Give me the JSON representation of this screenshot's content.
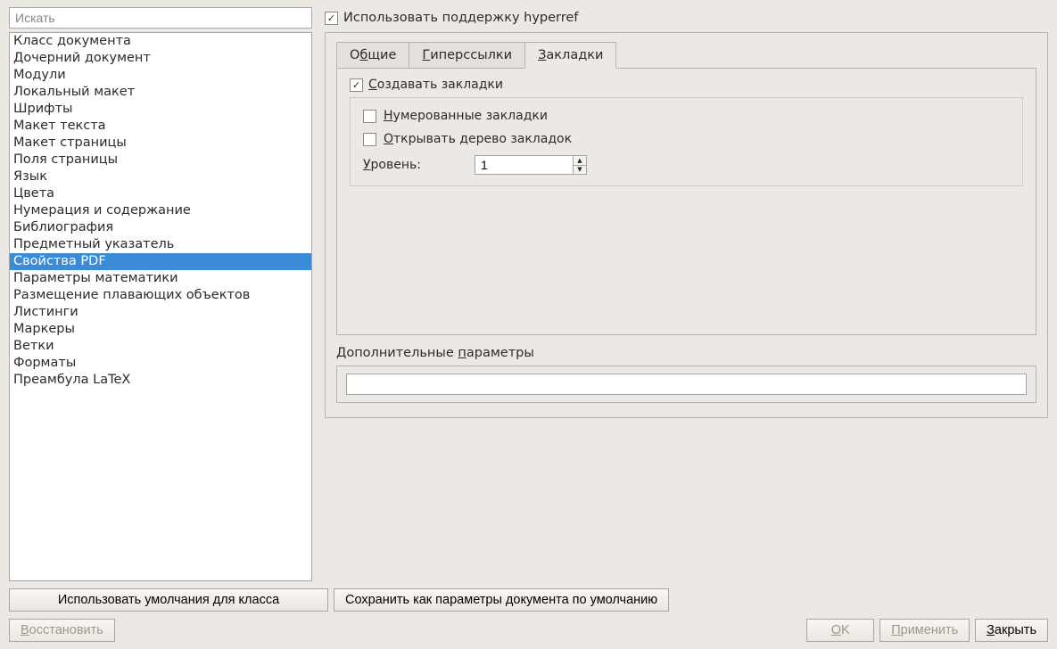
{
  "search": {
    "placeholder": "Искать"
  },
  "categories": [
    "Класс документа",
    "Дочерний документ",
    "Модули",
    "Локальный макет",
    "Шрифты",
    "Макет текста",
    "Макет страницы",
    "Поля страницы",
    "Язык",
    "Цвета",
    "Нумерация и содержание",
    "Библиография",
    "Предметный указатель",
    "Свойства PDF",
    "Параметры математики",
    "Размещение плавающих объектов",
    "Листинги",
    "Маркеры",
    "Ветки",
    "Форматы",
    "Преамбула LaTeX"
  ],
  "selected_index": 13,
  "hyperref_label": "Использовать поддержку hyperref",
  "hyperref_checked": true,
  "tabs": {
    "general": {
      "pre": "О",
      "u": "б",
      "post": "щие"
    },
    "hyperlinks": {
      "pre": "",
      "u": "Г",
      "post": "иперссылки"
    },
    "bookmarks": {
      "pre": "",
      "u": "З",
      "post": "акладки"
    }
  },
  "active_tab": "bookmarks",
  "group": {
    "checked": true,
    "label": {
      "pre": "",
      "u": "С",
      "post": "оздавать закладки"
    }
  },
  "numbered": {
    "checked": false,
    "label": {
      "pre": "",
      "u": "Н",
      "post": "умерованные закладки"
    }
  },
  "open_tree": {
    "checked": false,
    "label": {
      "pre": "",
      "u": "О",
      "post": "ткрывать дерево закладок"
    }
  },
  "level": {
    "label": {
      "pre": "",
      "u": "У",
      "post": "ровень:"
    },
    "value": "1"
  },
  "extra": {
    "label": {
      "pre": "Дополнительные ",
      "u": "п",
      "post": "араметры"
    },
    "value": ""
  },
  "buttons": {
    "use_class_defaults": "Использовать умолчания для класса",
    "save_as_defaults": "Сохранить как параметры документа по умолчанию",
    "restore": {
      "pre": "",
      "u": "В",
      "post": "осстановить"
    },
    "ok": {
      "pre": "",
      "u": "O",
      "post": "K"
    },
    "apply": {
      "pre": "",
      "u": "П",
      "post": "рименить"
    },
    "close": {
      "pre": "",
      "u": "З",
      "post": "акрыть"
    }
  }
}
